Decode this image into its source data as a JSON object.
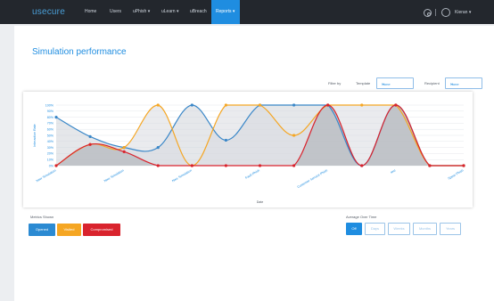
{
  "app": {
    "logo": "usecure",
    "username": "Kieran",
    "user_chevron": "▾"
  },
  "nav": [
    {
      "label": "Home"
    },
    {
      "label": "Users"
    },
    {
      "label": "uPhish",
      "chevron": "▾"
    },
    {
      "label": "uLearn",
      "chevron": "▾"
    },
    {
      "label": "uBreach"
    }
  ],
  "nav_active": {
    "label": "Reports ▾"
  },
  "icons": {
    "settings": "gear-icon",
    "user": "user-icon"
  },
  "page": {
    "title": "Simulation performance"
  },
  "filters": {
    "label": "Filter by",
    "template_label": "Template",
    "template_value": "None",
    "recipient_label": "Recipient",
    "recipient_value": "None",
    "chevron": "⌄"
  },
  "chart_data": {
    "type": "area",
    "ylabel": "Interaction Rate",
    "xlabel": "Date",
    "yticks": [
      "0%",
      "10%",
      "20%",
      "30%",
      "40%",
      "50%",
      "60%",
      "70%",
      "80%",
      "90%",
      "100%"
    ],
    "ylim": [
      0,
      100
    ],
    "x_labels": [
      "New Simulation",
      "New Simulation",
      "New Simulation",
      "Fault Phish",
      "Customer Service Phish",
      "test",
      "Spear Phish"
    ],
    "grid": true,
    "series": [
      {
        "name": "Opened",
        "color": "#3a87c8",
        "values": [
          80,
          48,
          30,
          30,
          100,
          42,
          100,
          100,
          100,
          0,
          100,
          0,
          0
        ]
      },
      {
        "name": "Visited",
        "color": "#f5a623",
        "values": [
          0,
          35,
          30,
          100,
          0,
          100,
          100,
          50,
          100,
          100,
          100,
          0,
          0
        ]
      },
      {
        "name": "Compromised",
        "color": "#d9232d",
        "values": [
          0,
          35,
          23,
          0,
          0,
          0,
          0,
          0,
          100,
          0,
          100,
          0,
          0
        ]
      }
    ]
  },
  "metrics": {
    "label": "Metrics Shown",
    "buttons": [
      {
        "label": "Opened",
        "color": "#2b8ad2"
      },
      {
        "label": "Visited",
        "color": "#f5a623"
      },
      {
        "label": "Compromised",
        "color": "#d9232d"
      }
    ]
  },
  "average": {
    "label": "Average Over Time",
    "buttons": [
      {
        "label": "Off",
        "active": true
      },
      {
        "label": "Days"
      },
      {
        "label": "Weeks"
      },
      {
        "label": "Months"
      },
      {
        "label": "Years"
      }
    ]
  }
}
